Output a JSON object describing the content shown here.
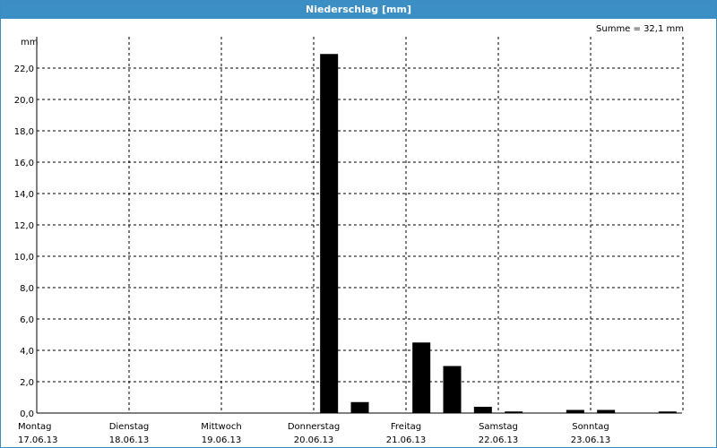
{
  "window": {
    "title": "Niederschlag [mm]"
  },
  "summary": "Summe = 32,1 mm",
  "chart_data": {
    "type": "bar",
    "unit_label": "mm",
    "ylim": [
      0,
      24
    ],
    "ytick_values": [
      0,
      2,
      4,
      6,
      8,
      10,
      12,
      14,
      16,
      18,
      20,
      22
    ],
    "ytick_labels": [
      "0,0",
      "2,0",
      "4,0",
      "6,0",
      "8,0",
      "10,0",
      "12,0",
      "14,0",
      "16,0",
      "18,0",
      "20,0",
      "22,0"
    ],
    "days": [
      {
        "day": "Montag",
        "date": "17.06.13"
      },
      {
        "day": "Dienstag",
        "date": "18.06.13"
      },
      {
        "day": "Mittwoch",
        "date": "19.06.13"
      },
      {
        "day": "Donnerstag",
        "date": "20.06.13"
      },
      {
        "day": "Freitag",
        "date": "21.06.13"
      },
      {
        "day": "Samstag",
        "date": "22.06.13"
      },
      {
        "day": "Sonntag",
        "date": "23.06.13"
      }
    ],
    "bar_interval": "8h",
    "bar_values": [
      0,
      0,
      0,
      0,
      0,
      0,
      0,
      0,
      0,
      22.9,
      0.7,
      0,
      4.5,
      3.0,
      0.4,
      0.1,
      0,
      0.2,
      0.2,
      0,
      0.1
    ],
    "grid": true
  }
}
